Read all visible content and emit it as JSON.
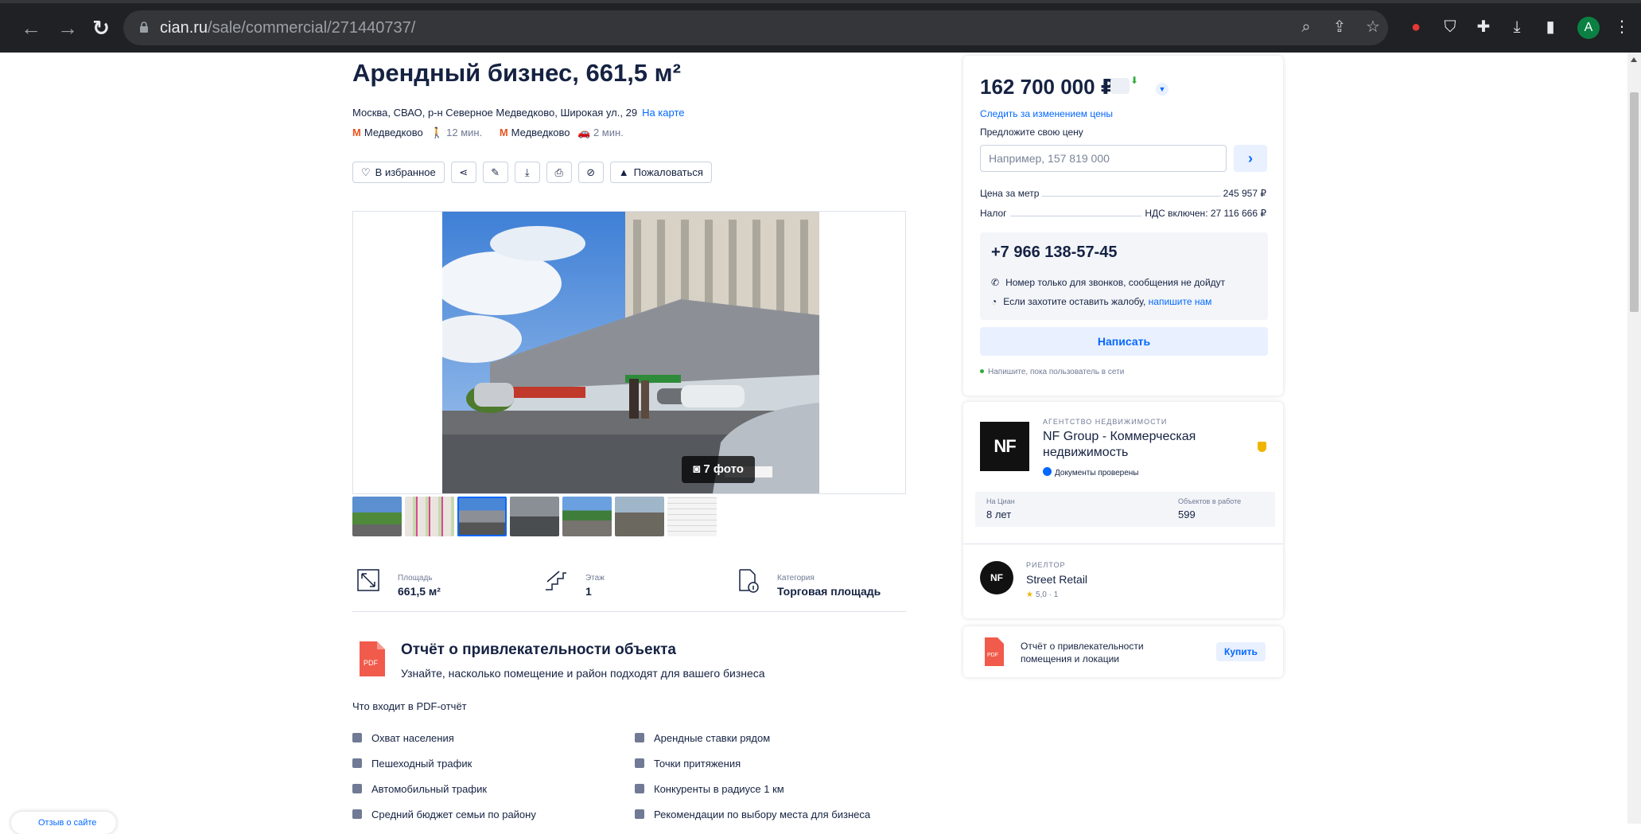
{
  "browser": {
    "url_domain": "cian.ru",
    "url_path": "/sale/commercial/271440737/",
    "avatar_letter": "A"
  },
  "listing": {
    "title": "Арендный бизнес, 661,5 м²",
    "address": "Москва, СВАО, р-н Северное Медведково, Широкая ул., 29",
    "map_link": "На карте",
    "metro": [
      {
        "station": "Медведково",
        "time": "12 мин.",
        "mode": "walk"
      },
      {
        "station": "Медведково",
        "time": "2 мин.",
        "mode": "car"
      }
    ],
    "actions": {
      "favorite": "В избранное",
      "complain": "Пожаловаться"
    },
    "photo_count": "7 фото",
    "features": [
      {
        "label": "Площадь",
        "value": "661,5 м²",
        "icon": "area-icon"
      },
      {
        "label": "Этаж",
        "value": "1",
        "icon": "stairs-icon"
      },
      {
        "label": "Категория",
        "value": "Торговая площадь",
        "icon": "document-info-icon"
      }
    ]
  },
  "report": {
    "title": "Отчёт о привлекательности объекта",
    "subtitle": "Узнайте, насколько помещение и район подходят для вашего бизнеса",
    "includes_heading": "Что входит в PDF-отчёт",
    "items_left": [
      "Охват населения",
      "Пешеходный трафик",
      "Автомобильный трафик",
      "Средний бюджет семьи по району"
    ],
    "items_right": [
      "Арендные ставки рядом",
      "Точки притяжения",
      "Конкуренты в радиусе 1 км",
      "Рекомендации по выбору места для бизнеса"
    ]
  },
  "price_card": {
    "price": "162 700 000 ₽",
    "track_price": "Следить за изменением цены",
    "offer_label": "Предложите свою цену",
    "offer_placeholder": "Например, 157 819 000",
    "per_meter_label": "Цена за метр",
    "per_meter_value": "245 957 ₽",
    "tax_label": "Налог",
    "tax_value": "НДС включен: 27 116 666 ₽",
    "phone": "+7 966 138-57-45",
    "phone_note": "Номер только для звонков, сообщения не дойдут",
    "complain_note": "Если захотите оставить жалобу,",
    "complain_link": "напишите нам",
    "write_button": "Написать",
    "online_note": "Напишите, пока пользователь в сети"
  },
  "agency": {
    "kind": "АГЕНТСТВО НЕДВИЖИМОСТИ",
    "name": "NF Group - Коммерческая недвижимость",
    "logo_text": "NF",
    "docs": "Документы проверены",
    "on_cian_label": "На Циан",
    "on_cian_value": "8 лет",
    "objects_label": "Объектов в работе",
    "objects_value": "599",
    "realtor_kind": "РИЕЛТОР",
    "realtor_name": "Street Retail",
    "realtor_rating": "5,0 · 1"
  },
  "report_card": {
    "text": "Отчёт о привлекательности помещения и локации",
    "button": "Купить"
  },
  "chat_float": "Отзыв о сайте"
}
